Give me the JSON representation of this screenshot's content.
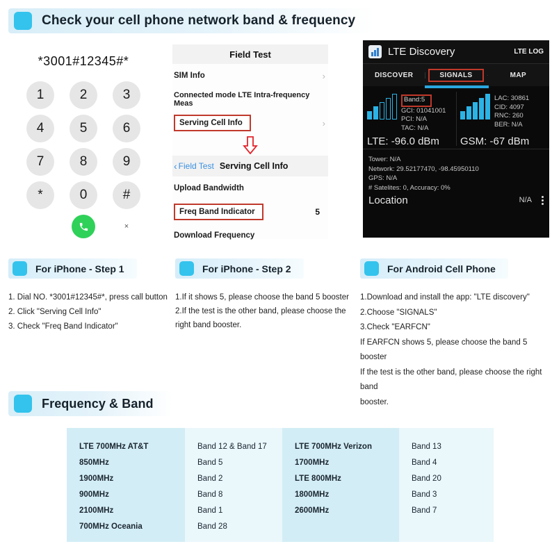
{
  "main_header": {
    "title": "Check your cell phone network band & frequency",
    "chip_color": "#33c3ec"
  },
  "dialer": {
    "number": "*3001#12345#*",
    "keys": [
      "1",
      "2",
      "3",
      "4",
      "5",
      "6",
      "7",
      "8",
      "9",
      "*",
      "0",
      "#"
    ],
    "call_icon": "phone-icon",
    "delete_label": "×"
  },
  "field_test": {
    "title": "Field Test",
    "rows": [
      {
        "label": "SIM Info",
        "chevron": "›"
      },
      {
        "label": "Connected mode LTE Intra-frequency Meas",
        "chevron": ""
      },
      {
        "label": "Serving Cell Info",
        "chevron": "›"
      }
    ],
    "arrow": "⇩",
    "sub_back": "Field Test",
    "sub_title": "Serving Cell Info",
    "detail_rows": [
      {
        "label": "Upload Bandwidth",
        "value": ""
      },
      {
        "label": "Freq Band Indicator",
        "value": "5"
      },
      {
        "label": "Download Frequency",
        "value": ""
      }
    ]
  },
  "android": {
    "app_name": "LTE Discovery",
    "log_label": "LTE LOG",
    "tabs": [
      {
        "label": "DISCOVER",
        "active": false
      },
      {
        "label": "SIGNALS",
        "active": true
      },
      {
        "label": "MAP",
        "active": false
      }
    ],
    "lte_card": {
      "band": "Band:5",
      "lines": [
        "GCI: 01041001",
        "PCI: N/A",
        "TAC: N/A"
      ],
      "dbm": "LTE: -96.0 dBm"
    },
    "gsm_card": {
      "lines": [
        "LAC: 30861",
        "CID: 4097",
        "RNC: 260",
        "BER: N/A"
      ],
      "dbm": "GSM: -67 dBm"
    },
    "location": {
      "tower": "Tower: N/A",
      "network": "Network: 29.52177470, -98.45950110",
      "gps": "GPS: N/A",
      "satellites": "# Satelites: 0, Accuracy: 0%",
      "title": "Location",
      "value": "N/A"
    }
  },
  "steps": [
    {
      "title": "For iPhone - Step 1",
      "lines": [
        "1. Dial NO. *3001#12345#*, press call button",
        "2. Click \"Serving Cell Info\"",
        "3. Check \"Freq Band Indicator\""
      ]
    },
    {
      "title": "For iPhone - Step 2",
      "lines": [
        "1.If it shows 5, please choose the band  5 booster",
        "2.If the test is the other band, please choose the",
        "right band booster."
      ]
    },
    {
      "title": "For Android Cell Phone",
      "lines": [
        "1.Download and install the app: \"LTE discovery\"",
        "2.Choose \"SIGNALS\"",
        "3.Check \"EARFCN\"",
        "If EARFCN  shows 5, please choose the band 5 booster",
        "If the test is the other band, please choose the right band",
        "booster."
      ]
    }
  ],
  "freq_header": {
    "title": "Frequency & Band",
    "chip_color": "#33c3ec"
  },
  "freq_table": {
    "col1": [
      "LTE  700MHz  AT&T",
      "850MHz",
      "1900MHz",
      "900MHz",
      "2100MHz",
      "700MHz Oceania"
    ],
    "col2": [
      "Band 12 & Band 17",
      "Band 5",
      "Band 2",
      "Band 8",
      "Band 1",
      "Band 28"
    ],
    "col3": [
      "LTE  700MHz  Verizon",
      "1700MHz",
      "LTE  800MHz",
      "1800MHz",
      "2600MHz"
    ],
    "col4": [
      "Band 13",
      "Band 4",
      "Band 20",
      "Band 3",
      "Band 7"
    ]
  }
}
